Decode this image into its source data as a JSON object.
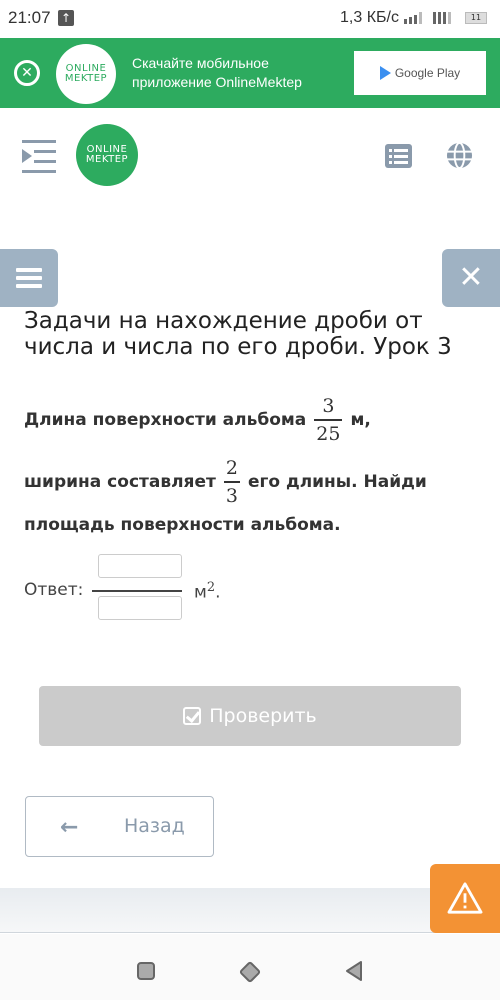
{
  "status_bar": {
    "time": "21:07",
    "upload_icon": "arrow-up-icon",
    "network_speed": "1,3 КБ/с",
    "battery": "11"
  },
  "banner": {
    "close_icon": "close-circle-icon",
    "logo_line1": "ONLINE",
    "logo_line2": "MEKTEP",
    "text_line1": "Скачайте мобильное",
    "text_line2": "приложение OnlineMektep",
    "store_button_label": "Google Play"
  },
  "header": {
    "logo_line1": "ONLINE",
    "logo_line2": "MEKTEP",
    "toc_icon": "indent-menu-icon",
    "list_icon": "list-icon",
    "globe_icon": "globe-icon"
  },
  "side_buttons": {
    "menu_icon": "hamburger-icon",
    "close_icon": "close-icon",
    "close_glyph": "✕"
  },
  "lesson": {
    "title": "Задачи на нахождение дроби от числа и числа по его дроби. Урок 3"
  },
  "problem": {
    "line1_text": "Длина поверхности альбома",
    "frac1": {
      "numerator": "3",
      "denominator": "25"
    },
    "line1_suffix": "м,",
    "line2_text": "ширина составляет",
    "frac2": {
      "numerator": "2",
      "denominator": "3"
    },
    "line2_suffix": "его длины. Найди",
    "line3_text": "площадь поверхности альбома."
  },
  "answer": {
    "label": "Ответ:",
    "numerator_value": "",
    "denominator_value": "",
    "unit": "м",
    "unit_power": "2",
    "unit_suffix": "."
  },
  "buttons": {
    "check_label": "Проверить",
    "back_label": "Назад",
    "back_arrow": "🡐"
  },
  "colors": {
    "brand_green": "#2dab5f",
    "side_button": "#9fb2c3",
    "report_orange": "#f39234",
    "check_disabled": "#cbcbcb"
  }
}
